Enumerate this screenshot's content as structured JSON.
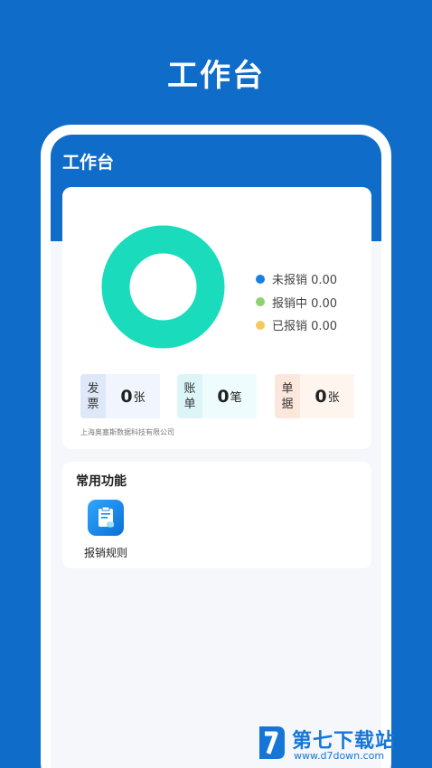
{
  "hero": {
    "title": "工作台"
  },
  "screen": {
    "title": "工作台"
  },
  "donut": {
    "ring_color": "#1adbbb"
  },
  "legend": [
    {
      "label": "未报销 0.00",
      "color": "#1a7fe0"
    },
    {
      "label": "报销中 0.00",
      "color": "#8fd16e"
    },
    {
      "label": "已报销 0.00",
      "color": "#f5c95b"
    }
  ],
  "stats": [
    {
      "label_line1": "发",
      "label_line2": "票",
      "value": "0",
      "unit": "张",
      "label_bg": "#dfe8f8",
      "value_bg": "#f1f5fd"
    },
    {
      "label_line1": "账",
      "label_line2": "单",
      "value": "0",
      "unit": "笔",
      "label_bg": "#dcf6f8",
      "value_bg": "#effcfd"
    },
    {
      "label_line1": "单",
      "label_line2": "据",
      "value": "0",
      "unit": "张",
      "label_bg": "#fbe7dc",
      "value_bg": "#fef5ef"
    }
  ],
  "company": "上海奥塞斯数据科技有限公司",
  "functions": {
    "title": "常用功能",
    "items": [
      {
        "label": "报销规则",
        "icon": "document-rules-icon"
      }
    ]
  },
  "watermark": {
    "text": "第七下载站",
    "url": "www.d7down.com"
  }
}
